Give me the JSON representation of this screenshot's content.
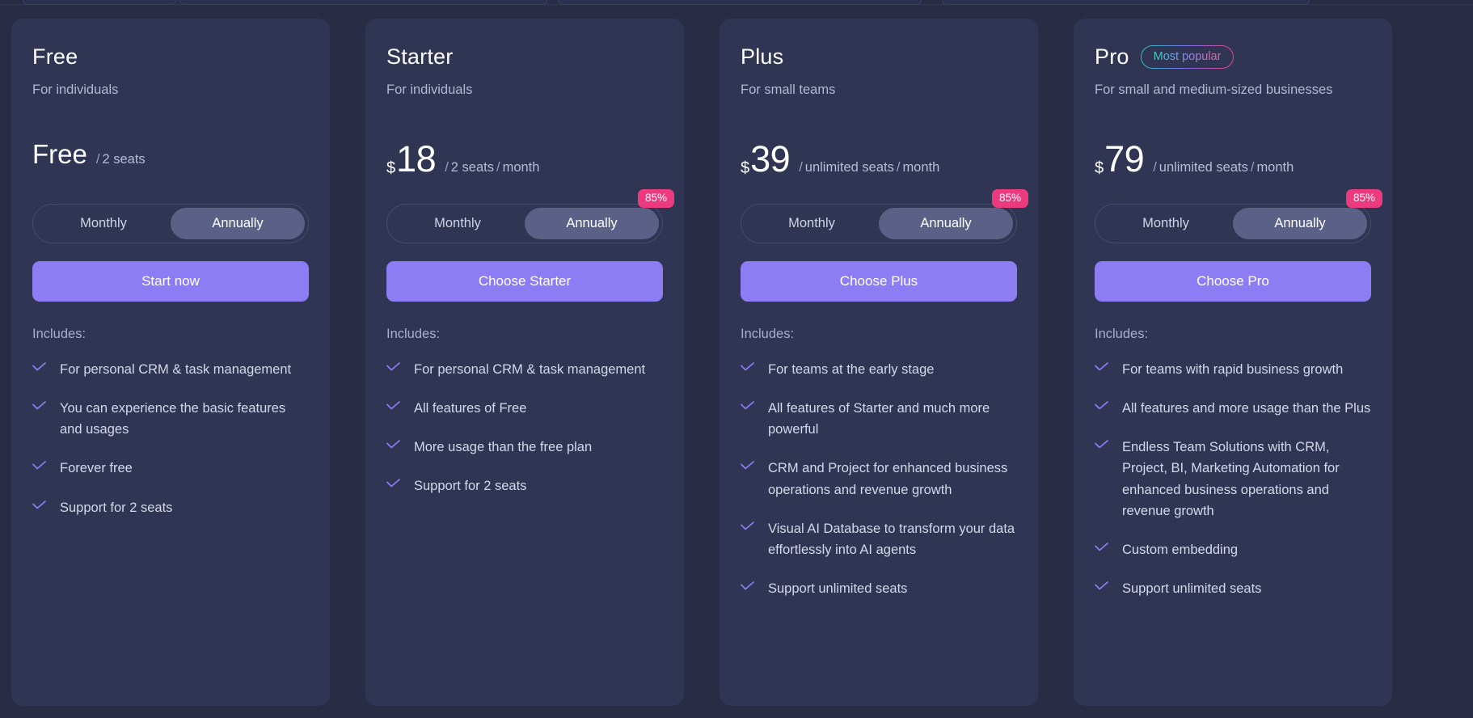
{
  "plans": [
    {
      "name": "Free",
      "badge": null,
      "audience": "For individuals",
      "currency": "",
      "amount": "Free",
      "amount_is_word": true,
      "unit_seats": "2  seats",
      "unit_period": "",
      "discount": null,
      "toggle": {
        "monthly": "Monthly",
        "annually": "Annually",
        "active": "Annually"
      },
      "cta": "Start now",
      "includes_label": "Includes:",
      "features": [
        "For personal CRM & task management",
        "You can experience the basic features and usages",
        "Forever free",
        "Support for 2 seats"
      ]
    },
    {
      "name": "Starter",
      "badge": null,
      "audience": "For individuals",
      "currency": "$",
      "amount": "18",
      "amount_is_word": false,
      "unit_seats": "2  seats",
      "unit_period": "month",
      "discount": "85%",
      "toggle": {
        "monthly": "Monthly",
        "annually": "Annually",
        "active": "Annually"
      },
      "cta": "Choose Starter",
      "includes_label": "Includes:",
      "features": [
        "For personal CRM & task management",
        "All features of Free",
        "More usage than the free plan",
        "Support for 2 seats"
      ]
    },
    {
      "name": "Plus",
      "badge": null,
      "audience": "For small teams",
      "currency": "$",
      "amount": "39",
      "amount_is_word": false,
      "unit_seats": "unlimited  seats",
      "unit_period": "month",
      "discount": "85%",
      "toggle": {
        "monthly": "Monthly",
        "annually": "Annually",
        "active": "Annually"
      },
      "cta": "Choose Plus",
      "includes_label": "Includes:",
      "features": [
        "For teams at the early stage",
        "All features of Starter and much more powerful",
        "CRM and Project for enhanced business operations and revenue growth",
        "Visual AI Database to transform your data effortlessly into AI agents",
        "Support unlimited seats"
      ]
    },
    {
      "name": "Pro",
      "badge": "Most popular",
      "audience": "For small and medium-sized businesses",
      "currency": "$",
      "amount": "79",
      "amount_is_word": false,
      "unit_seats": "unlimited  seats",
      "unit_period": "month",
      "discount": "85%",
      "toggle": {
        "monthly": "Monthly",
        "annually": "Annually",
        "active": "Annually"
      },
      "cta": "Choose Pro",
      "includes_label": "Includes:",
      "features": [
        "For teams with rapid business growth",
        "All features and more usage than the Plus",
        "Endless Team Solutions with CRM, Project, BI, Marketing Automation for enhanced business operations and revenue growth",
        "Custom embedding",
        "Support unlimited seats"
      ]
    }
  ],
  "colors": {
    "page_background": "#282d45",
    "card_background": "#2f3552",
    "cta_purple": "#8d7df5",
    "check_purple": "#8d7df5",
    "discount_pink": "#ec3a7e",
    "toggle_active": "#5a6086"
  },
  "icons": {
    "check": "check-icon"
  }
}
